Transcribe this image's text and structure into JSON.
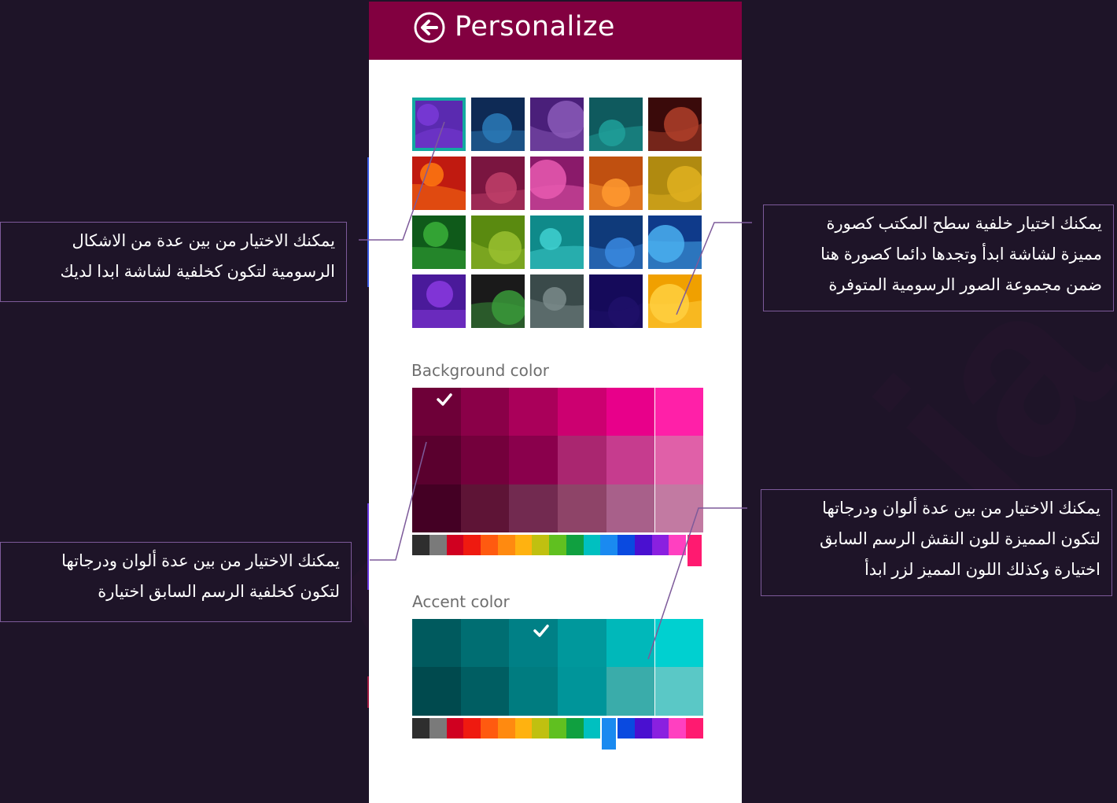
{
  "panel": {
    "title": "Personalize",
    "background_color_label": "Background color",
    "accent_color_label": "Accent color",
    "header_color": "#820040"
  },
  "patterns": {
    "tiles": [
      {
        "name": "pattern-1",
        "colors": [
          "#5a2ab0",
          "#7a3ad8"
        ],
        "selected": true
      },
      {
        "name": "pattern-2",
        "colors": [
          "#0e2a55",
          "#2a7ab8"
        ]
      },
      {
        "name": "pattern-3",
        "colors": [
          "#4a1f7a",
          "#8a5ab8"
        ]
      },
      {
        "name": "pattern-4",
        "colors": [
          "#0f5a5e",
          "#1fa09a"
        ]
      },
      {
        "name": "pattern-5",
        "colors": [
          "#3a0a0a",
          "#b0402a"
        ]
      },
      {
        "name": "pattern-6",
        "colors": [
          "#c01a10",
          "#ff7a10"
        ]
      },
      {
        "name": "pattern-7",
        "colors": [
          "#7a1540",
          "#c0406a"
        ]
      },
      {
        "name": "pattern-8",
        "colors": [
          "#8a1a6a",
          "#e85ab0"
        ]
      },
      {
        "name": "pattern-9",
        "colors": [
          "#c05010",
          "#ff9a30"
        ]
      },
      {
        "name": "pattern-10",
        "colors": [
          "#b08a10",
          "#e0b020"
        ]
      },
      {
        "name": "pattern-11",
        "colors": [
          "#0f5a1a",
          "#3ab03a"
        ]
      },
      {
        "name": "pattern-12",
        "colors": [
          "#5a8a10",
          "#9ac030"
        ]
      },
      {
        "name": "pattern-13",
        "colors": [
          "#0f8a8a",
          "#40d0d0"
        ]
      },
      {
        "name": "pattern-14",
        "colors": [
          "#0f3a7a",
          "#3a8ae0"
        ]
      },
      {
        "name": "pattern-15",
        "colors": [
          "#0f3a8a",
          "#4ab0f0"
        ]
      },
      {
        "name": "pattern-16",
        "colors": [
          "#4a1a9a",
          "#8a3ae0"
        ]
      },
      {
        "name": "pattern-17",
        "colors": [
          "#1a1a1a",
          "#3a9a3a"
        ]
      },
      {
        "name": "pattern-18",
        "colors": [
          "#3a4a4a",
          "#7a8a8a"
        ]
      },
      {
        "name": "pattern-19",
        "colors": [
          "#150a5a",
          "#1f106a"
        ]
      },
      {
        "name": "pattern-20",
        "colors": [
          "#f0a000",
          "#ffd040"
        ]
      }
    ]
  },
  "background_colors": {
    "grid": [
      [
        "#6e0038",
        "#8a0048",
        "#aa005a",
        "#cc0070",
        "#e8008a",
        "#ff20a8"
      ],
      [
        "#5a002e",
        "#74003c",
        "#8a004c",
        "#aa2670",
        "#c63c8e",
        "#e060a8"
      ],
      [
        "#440024",
        "#5e1436",
        "#722a50",
        "#8e4468",
        "#a8608a",
        "#c27aa2"
      ]
    ],
    "selected_index": [
      0,
      0
    ],
    "strip": [
      "#2e2e2e",
      "#7a7a7a",
      "#d00020",
      "#ef1a10",
      "#ff5a10",
      "#ff8a10",
      "#ffb210",
      "#c0c010",
      "#60c020",
      "#10a040",
      "#00c0c0",
      "#1a8af0",
      "#0a4ae0",
      "#4a10d0",
      "#8a20e0",
      "#ff40c0",
      "#ff1a70"
    ],
    "strip_selected": 16
  },
  "accent_colors": {
    "grid": [
      [
        "#005a5e",
        "#006e72",
        "#008086",
        "#00989c",
        "#00b8ba",
        "#00d0d0"
      ],
      [
        "#004a4e",
        "#005e62",
        "#007c80",
        "#00959a",
        "#3aacaa",
        "#5ac8c6"
      ]
    ],
    "selected_index": [
      0,
      2
    ],
    "strip": [
      "#2e2e2e",
      "#7a7a7a",
      "#d00020",
      "#ef1a10",
      "#ff5a10",
      "#ff8a10",
      "#ffb210",
      "#c0c010",
      "#60c020",
      "#10a040",
      "#00c0c0",
      "#1a8af0",
      "#0a4ae0",
      "#4a10d0",
      "#8a20e0",
      "#ff40c0",
      "#ff1a70"
    ],
    "strip_selected": 11
  },
  "callouts": {
    "left_top": {
      "line1": "يمكنك الاختيار من بين عدة من الاشكال",
      "line2": "الرسومية لتكون كخلفية لشاشة ابدا لديك"
    },
    "right_top": {
      "line1": "يمكنك اختيار خلفية سطح المكتب كصورة",
      "line2": "مميزة لشاشة ابدأ وتجدها دائما كصورة هنا",
      "line3": "ضمن مجموعة الصور الرسومية المتوفرة"
    },
    "left_bottom": {
      "line1": "يمكنك الاختيار من بين عدة ألوان ودرجاتها",
      "line2": "لتكون كخلفية الرسم السابق اختيارة"
    },
    "right_bottom": {
      "line1": "يمكنك الاختيار من بين عدة ألوان ودرجاتها",
      "line2": "لتكون المميزة للون النقش الرسم السابق",
      "line3": "اختيارة وكذلك اللون المميز لزر ابدأ"
    }
  }
}
